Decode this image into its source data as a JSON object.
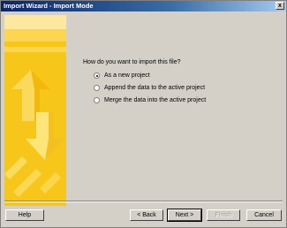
{
  "window": {
    "title": "Import Wizard - Import Mode",
    "close_label": "x"
  },
  "main": {
    "question": "How do you want to import this file?",
    "options": [
      {
        "label": "As a new project",
        "selected": true
      },
      {
        "label": "Append the data to the active project",
        "selected": false
      },
      {
        "label": "Merge the data into the active project",
        "selected": false
      }
    ]
  },
  "buttons": {
    "help": "Help",
    "back": "< Back",
    "next": "Next >",
    "finish": "Finish",
    "cancel": "Cancel"
  },
  "colors": {
    "banner_yellow": "#f7c61a",
    "banner_light": "#fde57a",
    "window_bg": "#d4d0c8"
  }
}
